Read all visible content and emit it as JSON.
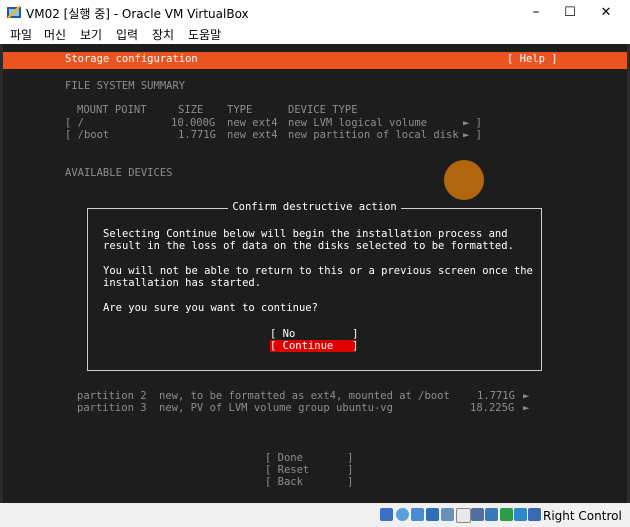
{
  "window": {
    "title": "VM02 [실행 중] - Oracle VM VirtualBox",
    "controls": [
      "–",
      "☐",
      "✕"
    ]
  },
  "menubar": {
    "items": [
      "파일",
      "머신",
      "보기",
      "입력",
      "장치",
      "도움말"
    ]
  },
  "installer": {
    "header": {
      "title": "Storage configuration",
      "help": "[ Help ]",
      "color": "#e95420"
    },
    "fs_summary": {
      "heading": "FILE SYSTEM SUMMARY",
      "columns": [
        "MOUNT POINT",
        "SIZE",
        "TYPE",
        "DEVICE TYPE"
      ],
      "rows": [
        {
          "mount": "[ /",
          "size": "10.000G",
          "type": "new ext4",
          "device": "new LVM logical volume",
          "arrow": "► ]"
        },
        {
          "mount": "[ /boot",
          "size": "1.771G",
          "type": "new ext4",
          "device": "new partition of local disk",
          "arrow": "► ]"
        }
      ]
    },
    "available_devices": {
      "heading": "AVAILABLE DEVICES"
    },
    "partitions": [
      {
        "name": "partition 2",
        "desc": "new, to be formatted as ext4, mounted at /boot",
        "size": "1.771G",
        "arrow": "►"
      },
      {
        "name": "partition 3",
        "desc": "new, PV of LVM volume group ubuntu-vg",
        "size": "18.225G",
        "arrow": "►"
      }
    ],
    "footer_buttons": [
      "[ Done       ]",
      "[ Reset      ]",
      "[ Back       ]"
    ],
    "dialog": {
      "title": "Confirm destructive action",
      "para1_line1": "Selecting Continue below will begin the installation process and",
      "para1_line2": "result in the loss of data on the disks selected to be formatted.",
      "para2_line1": "You will not be able to return to this or a previous screen once the",
      "para2_line2": "installation has started.",
      "question": "Are you sure you want to continue?",
      "btn_no": "[ No         ]",
      "btn_continue": "[ Continue   ]",
      "continue_color": "#e00000"
    }
  },
  "statusbar": {
    "host_key": "Right Control",
    "icons": [
      "hdd-icon",
      "optical-icon",
      "audio-icon",
      "network-icon",
      "usb-icon",
      "shared-folder-icon",
      "display-icon",
      "recording-icon",
      "cpu-icon",
      "mouse-integration-icon",
      "arrow-icon"
    ]
  }
}
